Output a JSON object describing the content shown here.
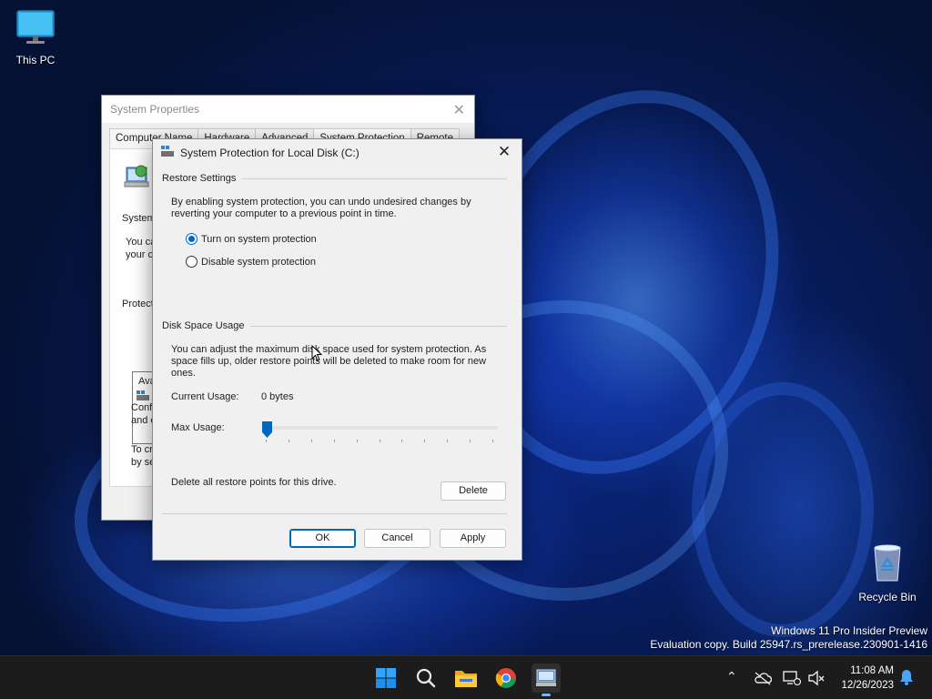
{
  "desktop": {
    "icons": [
      {
        "label": "This PC"
      },
      {
        "label": "Recycle Bin"
      }
    ],
    "watermark": {
      "line1": "Windows 11 Pro Insider Preview",
      "line2": "Evaluation copy. Build 25947.rs_prerelease.230901-1416"
    }
  },
  "system_properties": {
    "title": "System Properties",
    "tabs": [
      "Computer Name",
      "Hardware",
      "Advanced",
      "System Protection",
      "Remote"
    ],
    "fragments": {
      "system": "System",
      "you_ca": "You ca",
      "your_co": "your co",
      "protecti": "Protecti",
      "ava": "Ava",
      "confi": "Confi",
      "and_c": "and c",
      "to_cr": "To cr",
      "by_se": "by se"
    }
  },
  "dialog": {
    "title": "System Protection for Local Disk (C:)",
    "restore_settings": {
      "label": "Restore Settings",
      "description_line1": "By enabling system protection, you can undo undesired changes by",
      "description_line2": "reverting your computer to a previous point in time.",
      "options": [
        {
          "label": "Turn on system protection",
          "selected": true
        },
        {
          "label": "Disable system protection",
          "selected": false
        }
      ]
    },
    "disk_space": {
      "label": "Disk Space Usage",
      "description_line1": "You can adjust the maximum disk space used for system protection. As",
      "description_line2": "space fills up, older restore points will be deleted to make room for new",
      "description_line3": "ones.",
      "current_usage_label": "Current Usage:",
      "current_usage_value": "0 bytes",
      "max_usage_label": "Max Usage:",
      "max_usage_fraction": 0
    },
    "delete_text": "Delete all restore points for this drive.",
    "buttons": {
      "delete": "Delete",
      "ok": "OK",
      "cancel": "Cancel",
      "apply": "Apply"
    },
    "colors": {
      "accent": "#0067c0"
    }
  },
  "taskbar": {
    "apps": [
      "start-icon",
      "search-icon",
      "file-explorer-icon",
      "chrome-icon",
      "system-properties-icon"
    ],
    "clock": {
      "time": "11:08 AM",
      "date": "12/26/2023"
    }
  }
}
